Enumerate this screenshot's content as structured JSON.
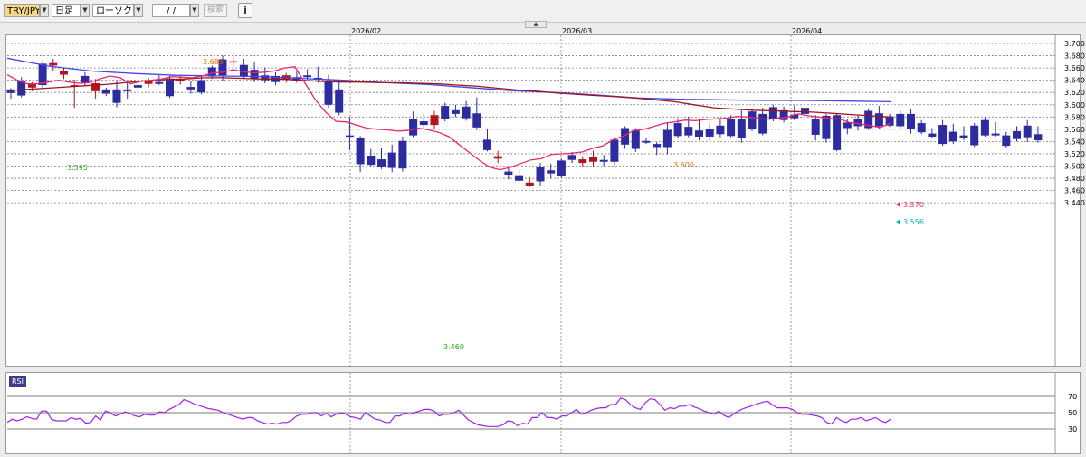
{
  "toolbar": {
    "pair": "TRY/JPY",
    "timeframe": "日足",
    "chart_type": "ローソク(BID)",
    "date": "/ /",
    "search_label": "検索",
    "info_icon": "info-icon"
  },
  "colors": {
    "up_candle": "#b4141e",
    "down_candle": "#2c2ca0",
    "ma_short": "#e8286e",
    "ma_mid": "#a0141e",
    "ma_long": "#4646e6",
    "rsi_line": "#a020f0",
    "high_label": "#e07000",
    "low_label": "#22aa22",
    "ma_tag": "#e8286e",
    "price_tag": "#00b4d2"
  },
  "chart_data": [
    {
      "type": "candlestick",
      "x_labels": [
        "2026/02",
        "2026/03",
        "2026/04"
      ],
      "y_ticks": [
        "3.700",
        "3.680",
        "3.660",
        "3.640",
        "3.620",
        "3.600",
        "3.580",
        "3.560",
        "3.540",
        "3.520",
        "3.500",
        "3.480",
        "3.460",
        "3.440"
      ],
      "ylim": [
        3.44,
        3.705
      ],
      "grid": true,
      "annotations": {
        "high_1": "3.685",
        "low_1": "3.595",
        "low_2": "3.460",
        "high_2": "3.600",
        "ma_tag": "3.570",
        "price_tag": "3.556"
      },
      "candles": [
        [
          3.625,
          3.627,
          3.61,
          3.619
        ],
        [
          3.638,
          3.645,
          3.612,
          3.615
        ],
        [
          3.628,
          3.637,
          3.622,
          3.634
        ],
        [
          3.667,
          3.671,
          3.628,
          3.632
        ],
        [
          3.664,
          3.675,
          3.655,
          3.668
        ],
        [
          3.649,
          3.66,
          3.642,
          3.655
        ],
        [
          3.631,
          3.641,
          3.595,
          3.632
        ],
        [
          3.647,
          3.653,
          3.632,
          3.635
        ],
        [
          3.622,
          3.642,
          3.61,
          3.635
        ],
        [
          3.625,
          3.628,
          3.614,
          3.618
        ],
        [
          3.625,
          3.638,
          3.596,
          3.603
        ],
        [
          3.625,
          3.638,
          3.61,
          3.622
        ],
        [
          3.632,
          3.642,
          3.622,
          3.628
        ],
        [
          3.634,
          3.644,
          3.628,
          3.64
        ],
        [
          3.637,
          3.648,
          3.632,
          3.634
        ],
        [
          3.643,
          3.647,
          3.611,
          3.614
        ],
        [
          3.639,
          3.647,
          3.633,
          3.642
        ],
        [
          3.629,
          3.638,
          3.618,
          3.625
        ],
        [
          3.64,
          3.648,
          3.617,
          3.62
        ],
        [
          3.661,
          3.664,
          3.642,
          3.646
        ],
        [
          3.674,
          3.68,
          3.638,
          3.648
        ],
        [
          3.67,
          3.685,
          3.662,
          3.671
        ],
        [
          3.665,
          3.675,
          3.643,
          3.646
        ],
        [
          3.657,
          3.669,
          3.637,
          3.642
        ],
        [
          3.648,
          3.661,
          3.635,
          3.64
        ],
        [
          3.647,
          3.653,
          3.632,
          3.637
        ],
        [
          3.642,
          3.652,
          3.636,
          3.648
        ],
        [
          3.645,
          3.654,
          3.636,
          3.64
        ],
        [
          3.648,
          3.658,
          3.641,
          3.645
        ],
        [
          3.644,
          3.662,
          3.636,
          3.641
        ],
        [
          3.638,
          3.649,
          3.595,
          3.6
        ],
        [
          3.625,
          3.637,
          3.583,
          3.587
        ],
        [
          3.55,
          3.58,
          3.526,
          3.548
        ],
        [
          3.545,
          3.549,
          3.49,
          3.503
        ],
        [
          3.517,
          3.528,
          3.5,
          3.502
        ],
        [
          3.511,
          3.53,
          3.495,
          3.499
        ],
        [
          3.522,
          3.535,
          3.49,
          3.497
        ],
        [
          3.541,
          3.548,
          3.491,
          3.496
        ],
        [
          3.576,
          3.589,
          3.547,
          3.55
        ],
        [
          3.573,
          3.585,
          3.561,
          3.567
        ],
        [
          3.567,
          3.59,
          3.56,
          3.583
        ],
        [
          3.598,
          3.603,
          3.573,
          3.577
        ],
        [
          3.591,
          3.6,
          3.58,
          3.585
        ],
        [
          3.597,
          3.606,
          3.574,
          3.578
        ],
        [
          3.586,
          3.612,
          3.559,
          3.563
        ],
        [
          3.543,
          3.56,
          3.524,
          3.526
        ],
        [
          3.512,
          3.525,
          3.505,
          3.516
        ],
        [
          3.491,
          3.498,
          3.478,
          3.486
        ],
        [
          3.485,
          3.494,
          3.472,
          3.476
        ],
        [
          3.467,
          3.482,
          3.466,
          3.473
        ],
        [
          3.499,
          3.505,
          3.468,
          3.475
        ],
        [
          3.493,
          3.504,
          3.48,
          3.488
        ],
        [
          3.509,
          3.512,
          3.481,
          3.484
        ],
        [
          3.518,
          3.523,
          3.505,
          3.51
        ],
        [
          3.505,
          3.516,
          3.499,
          3.511
        ],
        [
          3.507,
          3.525,
          3.499,
          3.514
        ],
        [
          3.51,
          3.518,
          3.5,
          3.507
        ],
        [
          3.543,
          3.546,
          3.502,
          3.507
        ],
        [
          3.562,
          3.565,
          3.528,
          3.535
        ],
        [
          3.558,
          3.562,
          3.523,
          3.528
        ],
        [
          3.541,
          3.545,
          3.536,
          3.538
        ],
        [
          3.536,
          3.539,
          3.518,
          3.531
        ],
        [
          3.559,
          3.571,
          3.519,
          3.531
        ],
        [
          3.57,
          3.578,
          3.545,
          3.549
        ],
        [
          3.564,
          3.58,
          3.547,
          3.55
        ],
        [
          3.558,
          3.577,
          3.542,
          3.548
        ],
        [
          3.56,
          3.57,
          3.541,
          3.548
        ],
        [
          3.566,
          3.578,
          3.547,
          3.552
        ],
        [
          3.576,
          3.583,
          3.547,
          3.549
        ],
        [
          3.577,
          3.591,
          3.538,
          3.545
        ],
        [
          3.589,
          3.592,
          3.557,
          3.56
        ],
        [
          3.585,
          3.595,
          3.55,
          3.553
        ],
        [
          3.596,
          3.6,
          3.573,
          3.576
        ],
        [
          3.591,
          3.597,
          3.571,
          3.575
        ],
        [
          3.584,
          3.599,
          3.575,
          3.578
        ],
        [
          3.595,
          3.6,
          3.57,
          3.585
        ],
        [
          3.576,
          3.583,
          3.542,
          3.551
        ],
        [
          3.582,
          3.585,
          3.538,
          3.544
        ],
        [
          3.583,
          3.586,
          3.524,
          3.526
        ],
        [
          3.571,
          3.576,
          3.552,
          3.562
        ],
        [
          3.576,
          3.583,
          3.558,
          3.565
        ],
        [
          3.59,
          3.594,
          3.559,
          3.562
        ],
        [
          3.586,
          3.598,
          3.56,
          3.565
        ],
        [
          3.581,
          3.585,
          3.564,
          3.566
        ],
        [
          3.585,
          3.59,
          3.561,
          3.565
        ],
        [
          3.585,
          3.592,
          3.553,
          3.56
        ],
        [
          3.57,
          3.575,
          3.552,
          3.555
        ],
        [
          3.553,
          3.562,
          3.545,
          3.548
        ],
        [
          3.567,
          3.575,
          3.533,
          3.536
        ],
        [
          3.556,
          3.569,
          3.536,
          3.54
        ],
        [
          3.55,
          3.565,
          3.542,
          3.545
        ],
        [
          3.566,
          3.57,
          3.531,
          3.534
        ],
        [
          3.575,
          3.58,
          3.548,
          3.55
        ],
        [
          3.553,
          3.572,
          3.548,
          3.55
        ],
        [
          3.55,
          3.556,
          3.53,
          3.533
        ],
        [
          3.557,
          3.565,
          3.54,
          3.544
        ],
        [
          3.566,
          3.575,
          3.539,
          3.547
        ],
        [
          3.552,
          3.565,
          3.538,
          3.542
        ]
      ],
      "ma_short": [
        3.649,
        3.64,
        3.634,
        3.634,
        3.637,
        3.64,
        3.637,
        3.635,
        3.636,
        3.642,
        3.647,
        3.644,
        3.634,
        3.638,
        3.64,
        3.642,
        3.646,
        3.645,
        3.644,
        3.647,
        3.652,
        3.653,
        3.657,
        3.654,
        3.652,
        3.653,
        3.655,
        3.66,
        3.662,
        3.635,
        3.608,
        3.588,
        3.573,
        3.572,
        3.567,
        3.562,
        3.56,
        3.559,
        3.557,
        3.558,
        3.562,
        3.559,
        3.555,
        3.548,
        3.535,
        3.522,
        3.509,
        3.498,
        3.494,
        3.498,
        3.504,
        3.51,
        3.512,
        3.519,
        3.52,
        3.521,
        3.523,
        3.529,
        3.533,
        3.543,
        3.549,
        3.558,
        3.56,
        3.565,
        3.57,
        3.572,
        3.575,
        3.574,
        3.576,
        3.577,
        3.578,
        3.581,
        3.58,
        3.578,
        3.576,
        3.578,
        3.58,
        3.585,
        3.582,
        3.58,
        3.578,
        3.577,
        3.571,
        3.569,
        3.566,
        3.563,
        3.57
      ],
      "ma_mid": [
        3.623,
        3.625,
        3.627,
        3.629,
        3.631,
        3.633,
        3.636,
        3.639,
        3.641,
        3.642,
        3.644,
        3.644,
        3.643,
        3.642,
        3.642,
        3.64,
        3.638,
        3.637,
        3.637,
        3.636,
        3.636,
        3.635,
        3.634,
        3.632,
        3.63,
        3.627,
        3.624,
        3.622,
        3.619,
        3.617,
        3.615,
        3.613,
        3.611,
        3.608,
        3.605,
        3.6,
        3.595,
        3.593,
        3.591,
        3.59,
        3.589,
        3.588,
        3.586,
        3.584,
        3.582,
        3.58
      ],
      "ma_long": [
        3.676,
        3.663,
        3.655,
        3.651,
        3.648,
        3.647,
        3.646,
        3.643,
        3.64,
        3.636,
        3.633,
        3.628,
        3.623,
        3.62,
        3.616,
        3.611,
        3.609,
        3.608,
        3.607,
        3.607,
        3.606,
        3.605
      ]
    },
    {
      "type": "line",
      "title": "RSI",
      "y_ticks": [
        "70",
        "50",
        "30"
      ],
      "ylim": [
        10,
        90
      ],
      "values": [
        38,
        42,
        40,
        42,
        45,
        43,
        42,
        52,
        52,
        42,
        40,
        40,
        40,
        44,
        42,
        43,
        37,
        38,
        46,
        41,
        52,
        50,
        46,
        48,
        51,
        49,
        46,
        45,
        48,
        47,
        47,
        51,
        50,
        54,
        57,
        60,
        66,
        64,
        61,
        59,
        57,
        55,
        54,
        53,
        50,
        48,
        46,
        44,
        42,
        44,
        44,
        40,
        38,
        36,
        37,
        36,
        38,
        38,
        41,
        46,
        48,
        48,
        50,
        50,
        46,
        49,
        45,
        48,
        50,
        48,
        45,
        44,
        42,
        50,
        46,
        42,
        41,
        38,
        38,
        46,
        46,
        50,
        48,
        50,
        52,
        54,
        54,
        52,
        46,
        48,
        48,
        50,
        53,
        47,
        41,
        38,
        35,
        34,
        33,
        33,
        33,
        35,
        40,
        39,
        34,
        37,
        36,
        44,
        44,
        50,
        44,
        44,
        42,
        46,
        46,
        50,
        54,
        48,
        50,
        53,
        55,
        56,
        56,
        60,
        60,
        68,
        66,
        60,
        56,
        54,
        62,
        67,
        66,
        60,
        53,
        56,
        55,
        58,
        58,
        60,
        57,
        55,
        52,
        50,
        48,
        52,
        47,
        44,
        48,
        52,
        55,
        57,
        59,
        61,
        63,
        64,
        59,
        56,
        56,
        56,
        54,
        50,
        48,
        48,
        47,
        46,
        44,
        38,
        36,
        44,
        40,
        38,
        42,
        42,
        44,
        40,
        42,
        44,
        40,
        38,
        42
      ]
    }
  ]
}
